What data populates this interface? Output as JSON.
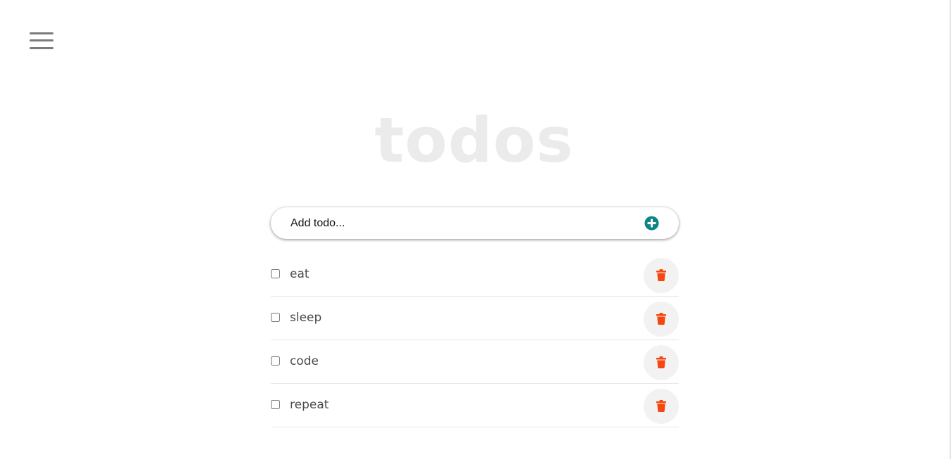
{
  "header": {
    "menu_icon": "hamburger-menu-icon"
  },
  "title": "todos",
  "add_form": {
    "placeholder": "Add todo...",
    "add_icon": "plus-circle-icon",
    "accent_color": "#0b8586"
  },
  "todos": [
    {
      "label": "eat",
      "checked": false
    },
    {
      "label": "sleep",
      "checked": false
    },
    {
      "label": "code",
      "checked": false
    },
    {
      "label": "repeat",
      "checked": false
    }
  ],
  "delete_icon": "trash-icon",
  "delete_color": "#f5470f"
}
